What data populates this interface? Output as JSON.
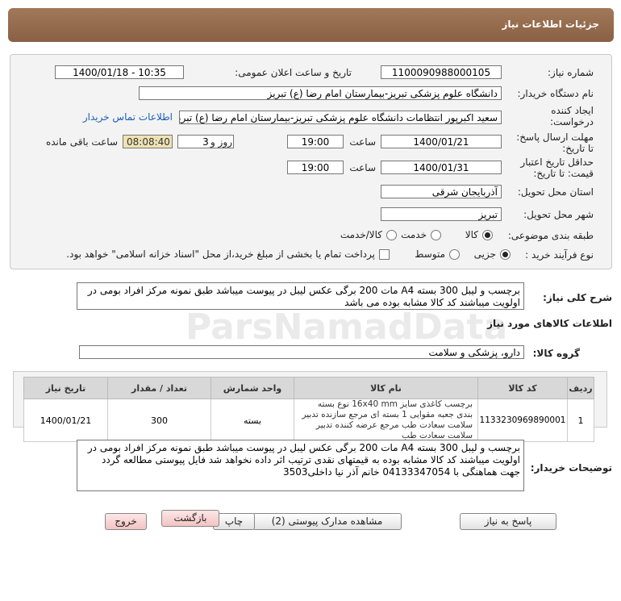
{
  "title": "جزئیات اطلاعات نیاز",
  "form": {
    "need_number_label": "شماره نیاز:",
    "need_number": "1100090988000105",
    "announce_label": "تاریخ و ساعت اعلان عمومی:",
    "announce_value": "1400/01/18 - 10:35",
    "buyer_org_label": "نام دستگاه خریدار:",
    "buyer_org": "دانشگاه علوم پزشکی تبریز-بیمارستان امام رضا (ع) تبریز",
    "creator_label": "ایجاد کننده درخواست:",
    "creator": "سعید اکبرپور انتظامات دانشگاه علوم پزشکی تبریز-بیمارستان امام رضا (ع) تبریز",
    "contact_link": "اطلاعات تماس خریدار",
    "reply_deadline_label": "مهلت ارسال پاسخ: تا تاریخ:",
    "reply_date": "1400/01/21",
    "time_label": "ساعت",
    "reply_time": "19:00",
    "days_value": "3",
    "days_label": "روز و",
    "remaining_time": "08:08:40",
    "remaining_label": "ساعت باقی مانده",
    "validity_label": "حداقل تاریخ اعتبار قیمت: تا تاریخ:",
    "validity_date": "1400/01/31",
    "validity_time": "19:00",
    "province_label": "استان محل تحویل:",
    "province": "آذربایجان شرقی",
    "city_label": "شهر محل تحویل:",
    "city": "تبریز",
    "category_label": "طبقه بندی موضوعی:",
    "category_options": [
      "کالا",
      "خدمت",
      "کالا/خدمت"
    ],
    "category_selected": "کالا",
    "process_label": "نوع فرآیند خرید :",
    "process_options": [
      "جزیی",
      "متوسط"
    ],
    "process_selected": "جزیی",
    "treasury_text": "پرداخت تمام یا بخشی از مبلغ خرید،از محل \"اسناد خزانه اسلامی\" خواهد بود."
  },
  "summary": {
    "label": "شرح کلی نیاز:",
    "text": "برچسب و لیبل 300 بسته A4 مات 200 برگی عکس لیبل در پیوست میباشد طبق نمونه مرکز افراد بومی در اولویت میباشند کد کالا مشابه بوده می باشد"
  },
  "goods_info_title": "اطلاعات کالاهای مورد نیاز",
  "group": {
    "label": "گروه کالا:",
    "value": "دارو، پزشکی و سلامت"
  },
  "table": {
    "headers": [
      "ردیف",
      "کد کالا",
      "نام کالا",
      "واحد شمارش",
      "تعداد / مقدار",
      "تاریخ نیاز"
    ],
    "rows": [
      {
        "row": "1",
        "code": "1133230969890001",
        "name": "برچسب کاغذی سایز 16x40 mm نوع بسته بندی جعبه مقوایی 1 بسته ای مرجع سازنده تدبیر سلامت سعادت طب مرجع عرضه کننده تدبیر سلامت سعادت طب",
        "unit": "بسته",
        "qty": "300",
        "date": "1400/01/21"
      }
    ]
  },
  "buyer_notes": {
    "label": "توضیحات خریدار:",
    "text": "برچسب و لیبل 300 بسته A4 مات 200 برگی عکس لیبل در پیوست میباشد طبق نمونه مرکز افراد بومی در اولویت میباشند کد کالا مشابه بوده به قیمتهای نقدی ترتیب اثر داده نخواهد شد فایل پیوستی مطالعه گردد جهت هماهنگی با 04133347054 خانم آذر نیا داخلی3503"
  },
  "buttons": {
    "reply": "پاسخ به نیاز",
    "attachments": "مشاهده مدارک پیوستی (2)",
    "print": "چاپ",
    "back": "بازگشت",
    "exit": "خروج"
  }
}
